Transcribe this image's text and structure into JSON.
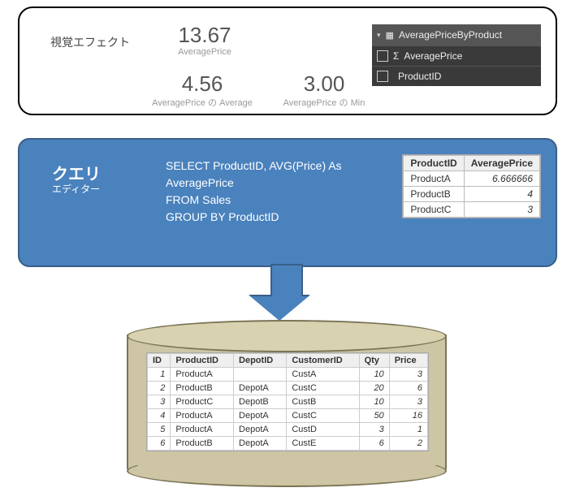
{
  "visual": {
    "label": "視覚エフェクト",
    "metrics": [
      {
        "value": "13.67",
        "caption": "AveragePrice"
      },
      {
        "value": "4.56",
        "caption": "AveragePrice の Average"
      },
      {
        "value": "3.00",
        "caption": "AveragePrice の Min"
      }
    ],
    "fields": {
      "table": "AveragePriceByProduct",
      "columns": [
        {
          "name": "AveragePrice",
          "sigma": "Σ"
        },
        {
          "name": "ProductID",
          "sigma": ""
        }
      ]
    }
  },
  "query": {
    "title": "クエリ",
    "subtitle": "エディター",
    "sql": "SELECT ProductID, AVG(Price) As\nAveragePrice\nFROM Sales\nGROUP BY ProductID",
    "result": {
      "headers": [
        "ProductID",
        "AveragePrice"
      ],
      "rows": [
        [
          "ProductA",
          "6.666666"
        ],
        [
          "ProductB",
          "4"
        ],
        [
          "ProductC",
          "3"
        ]
      ]
    }
  },
  "sales": {
    "headers": [
      "ID",
      "ProductID",
      "DepotID",
      "CustomerID",
      "Qty",
      "Price"
    ],
    "rows": [
      [
        "1",
        "ProductA",
        "",
        "CustA",
        "10",
        "3"
      ],
      [
        "2",
        "ProductB",
        "DepotA",
        "CustC",
        "20",
        "6"
      ],
      [
        "3",
        "ProductC",
        "DepotB",
        "CustB",
        "10",
        "3"
      ],
      [
        "4",
        "ProductA",
        "DepotA",
        "CustC",
        "50",
        "16"
      ],
      [
        "5",
        "ProductA",
        "DepotA",
        "CustD",
        "3",
        "1"
      ],
      [
        "6",
        "ProductB",
        "DepotA",
        "CustE",
        "6",
        "2"
      ]
    ]
  }
}
